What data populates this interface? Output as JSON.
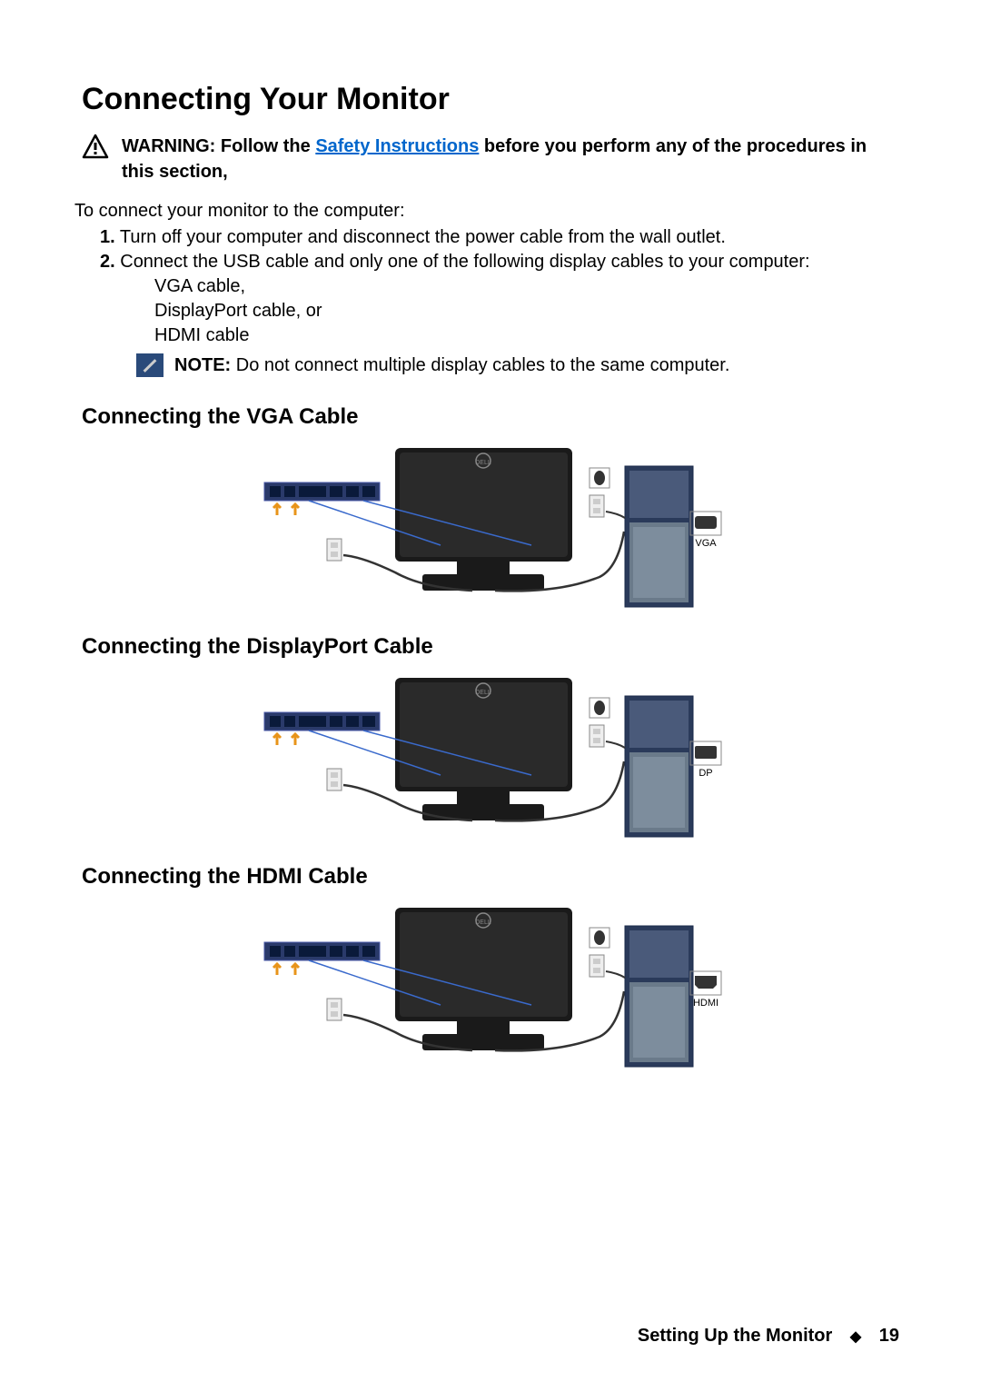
{
  "title": "Connecting Your Monitor",
  "warning": {
    "prefix": "WARNING: Follow the ",
    "link": "Safety Instructions",
    "suffix": " before you perform any of the procedures in this section,"
  },
  "intro": "To connect your monitor to the computer:",
  "steps": {
    "s1_num": "1.",
    "s1_text": " Turn off your computer and disconnect the power cable from the wall outlet.",
    "s2_num": "2.",
    "s2_text": " Connect the USB cable and only one of the following display cables to your computer:"
  },
  "cables": {
    "c1": "VGA cable,",
    "c2": "DisplayPort cable, or",
    "c3": "HDMI cable"
  },
  "note": {
    "label": "NOTE:",
    "text": " Do not connect multiple display cables to the same computer."
  },
  "sections": {
    "vga": {
      "heading": "Connecting the VGA Cable",
      "connector_label": "VGA"
    },
    "dp": {
      "heading": "Connecting the DisplayPort Cable",
      "connector_label": "DP"
    },
    "hdmi": {
      "heading": "Connecting the HDMI Cable",
      "connector_label": "HDMI"
    }
  },
  "footer": {
    "section": "Setting Up the Monitor",
    "page": "19"
  }
}
